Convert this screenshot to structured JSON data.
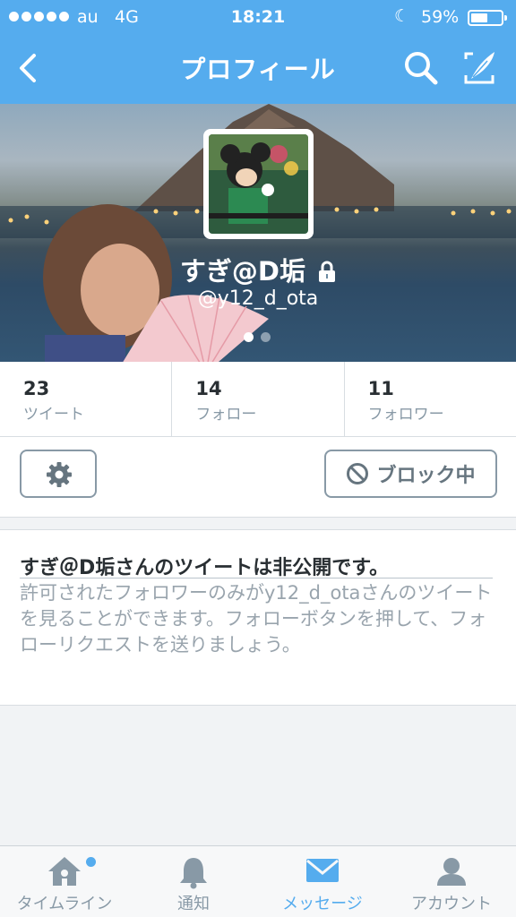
{
  "status_bar": {
    "carrier": "au",
    "network": "4G",
    "time": "18:21",
    "battery": "59%",
    "battery_level": 0.59,
    "do_not_disturb_icon": "moon-icon"
  },
  "nav": {
    "title": "プロフィール",
    "back_icon": "chevron-left-icon",
    "search_icon": "search-icon",
    "compose_icon": "compose-icon"
  },
  "profile": {
    "display_name": "すぎ@D垢",
    "handle": "@y12_d_ota",
    "protected_icon": "lock-icon",
    "header_pages": 2,
    "header_page_active": 1
  },
  "stats": [
    {
      "count": "23",
      "label": "ツイート"
    },
    {
      "count": "14",
      "label": "フォロー"
    },
    {
      "count": "11",
      "label": "フォロワー"
    }
  ],
  "actions": {
    "settings_icon": "gear-icon",
    "block_label": "ブロック中",
    "block_icon": "block-icon"
  },
  "protected_notice": {
    "title": "すぎ＠D垢さんのツイートは非公開です。",
    "body": "許可されたフォロワーのみがy12_d_otaさんのツイートを見ることができます。フォローボタンを押して、フォローリクエストを送りましょう。"
  },
  "tabs": [
    {
      "label": "タイムライン",
      "icon": "home-icon",
      "active": false
    },
    {
      "label": "通知",
      "icon": "bell-icon",
      "active": false
    },
    {
      "label": "メッセージ",
      "icon": "envelope-icon",
      "active": true
    },
    {
      "label": "アカウント",
      "icon": "person-icon",
      "active": false
    }
  ],
  "colors": {
    "brand": "#55acee",
    "muted": "#8899a6",
    "text": "#292f33"
  }
}
